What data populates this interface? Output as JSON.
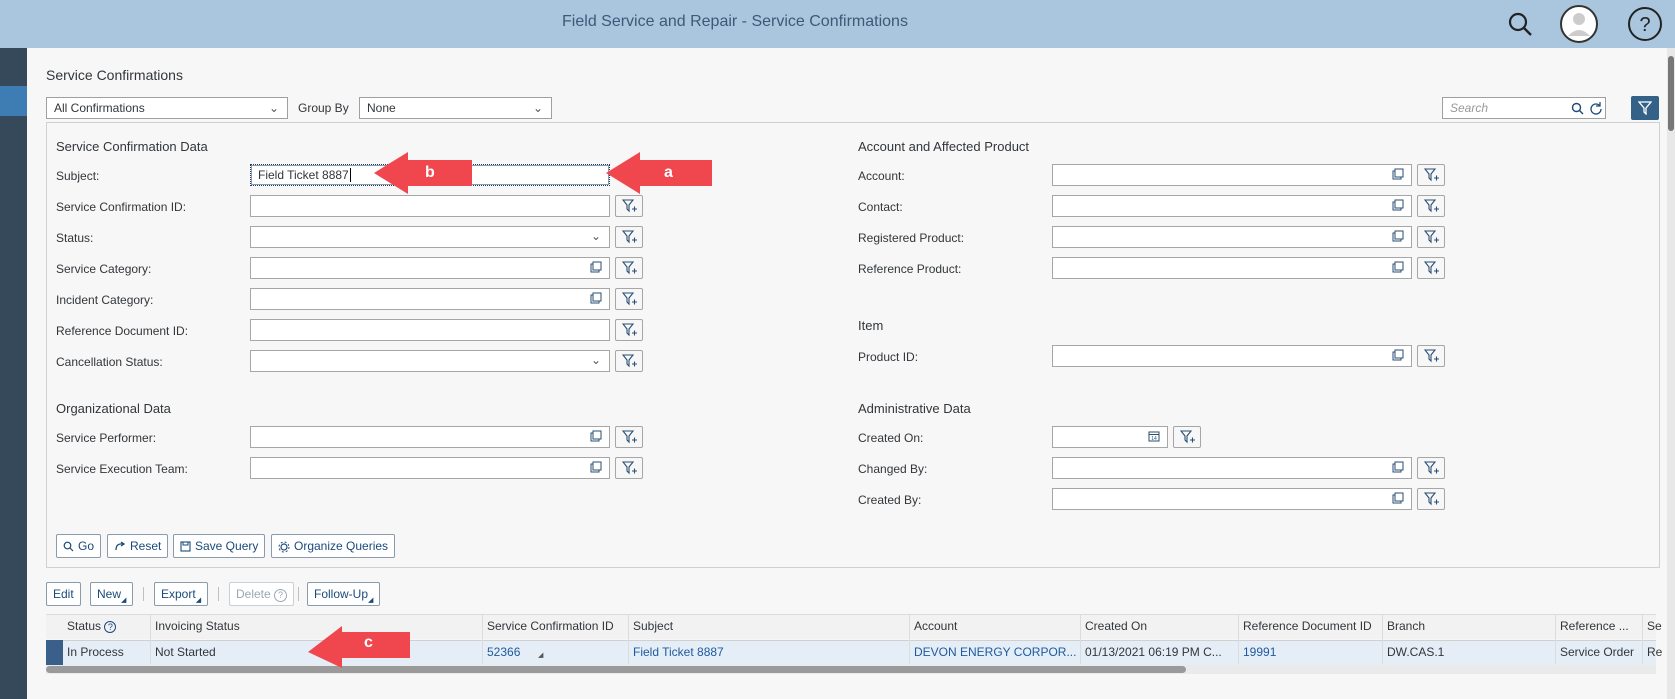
{
  "app": {
    "title": "Field Service and Repair - Service Confirmations"
  },
  "page": {
    "title": "Service Confirmations"
  },
  "toolbar": {
    "view_select": "All Confirmations",
    "group_by_label": "Group By",
    "group_by_value": "None",
    "search_placeholder": "Search"
  },
  "sections": {
    "service_confirmation_data": "Service Confirmation Data",
    "account_product": "Account and Affected Product",
    "item": "Item",
    "organizational_data": "Organizational Data",
    "administrative_data": "Administrative Data"
  },
  "fields": {
    "subject": {
      "label": "Subject:",
      "value": "Field Ticket 8887"
    },
    "service_confirmation_id": {
      "label": "Service Confirmation ID:"
    },
    "status": {
      "label": "Status:"
    },
    "service_category": {
      "label": "Service Category:"
    },
    "incident_category": {
      "label": "Incident Category:"
    },
    "reference_document_id": {
      "label": "Reference Document ID:"
    },
    "cancellation_status": {
      "label": "Cancellation Status:"
    },
    "service_performer": {
      "label": "Service Performer:"
    },
    "service_execution_team": {
      "label": "Service Execution Team:"
    },
    "account": {
      "label": "Account:"
    },
    "contact": {
      "label": "Contact:"
    },
    "registered_product": {
      "label": "Registered Product:"
    },
    "reference_product": {
      "label": "Reference Product:"
    },
    "product_id": {
      "label": "Product ID:"
    },
    "created_on": {
      "label": "Created On:"
    },
    "changed_by": {
      "label": "Changed By:"
    },
    "created_by": {
      "label": "Created By:"
    }
  },
  "query_buttons": {
    "go": "Go",
    "reset": "Reset",
    "save_query": "Save Query",
    "organize_queries": "Organize Queries"
  },
  "table_toolbar": {
    "edit": "Edit",
    "new": "New",
    "export": "Export",
    "delete": "Delete",
    "follow_up": "Follow-Up"
  },
  "table": {
    "columns": [
      "Status",
      "Invoicing Status",
      "Service Confirmation ID",
      "Subject",
      "Account",
      "Created On",
      "Reference Document ID",
      "Branch",
      "Reference ...",
      "Se"
    ],
    "rows": [
      [
        "In Process",
        "Not Started",
        "52366",
        "Field Ticket 8887",
        "DEVON ENERGY CORPOR...",
        "01/13/2021 06:19 PM C...",
        "19991",
        "DW.CAS.1",
        "Service Order",
        "Re"
      ]
    ]
  },
  "annotations": {
    "a": "a",
    "b": "b",
    "c": "c"
  },
  "colors": {
    "shellbar": "#a9c6de",
    "arrow": "#f0474f",
    "link": "#1e5aa0"
  },
  "icons": [
    "search-icon",
    "user-avatar-icon",
    "help-icon",
    "filter-icon",
    "refresh-icon",
    "value-help-icon",
    "calendar-icon"
  ]
}
